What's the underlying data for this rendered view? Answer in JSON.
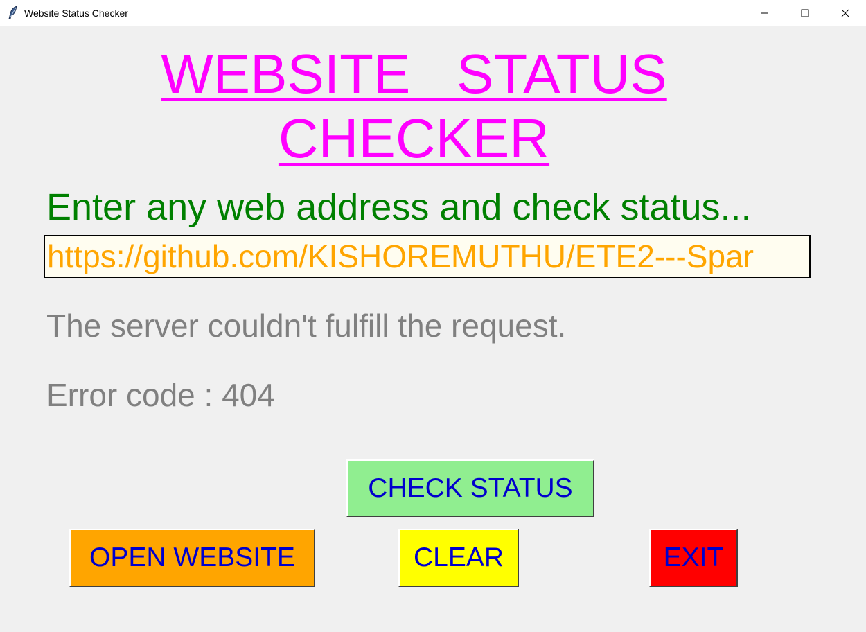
{
  "window": {
    "title": "Website Status Checker",
    "icon": "feather-icon",
    "controls": {
      "minimize_icon": "minimize-icon",
      "maximize_icon": "maximize-icon",
      "close_icon": "close-icon"
    }
  },
  "main": {
    "title_line1": "WEBSITE   STATUS",
    "title_line2": "CHECKER",
    "prompt": "Enter any web address and check status...",
    "url_value": "https://github.com/KISHOREMUTHU/ETE2---Spar",
    "status_message": "The server couldn't fulfill the request.",
    "error_code": "Error code : 404"
  },
  "buttons": {
    "check_status": "CHECK STATUS",
    "open_website": "OPEN WEBSITE",
    "clear": "CLEAR",
    "exit": "EXIT"
  },
  "colors": {
    "title": "#ff00ff",
    "prompt": "#008000",
    "url_text": "#ffa500",
    "status_text": "#808080",
    "button_text": "#0000cd",
    "check_status_bg": "#90ee90",
    "open_website_bg": "#ffa500",
    "clear_bg": "#ffff00",
    "exit_bg": "#ff0000",
    "background": "#f0f0f0"
  }
}
